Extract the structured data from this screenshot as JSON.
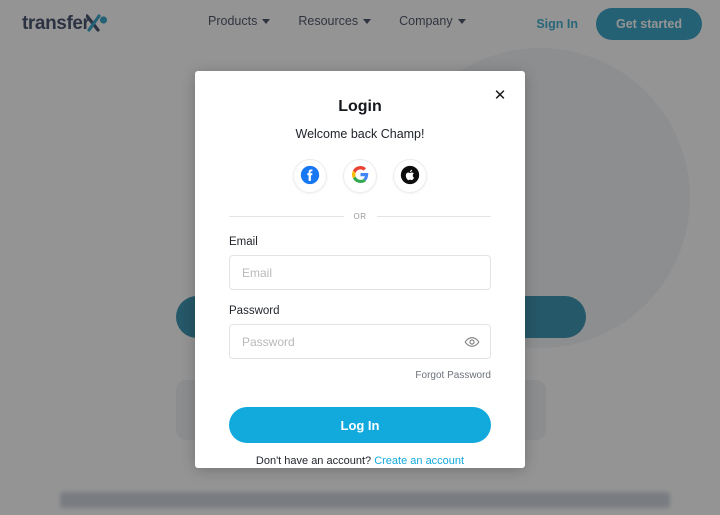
{
  "site": {
    "logo": {
      "text": "transfer",
      "mark_icon": "transferx-x-mark-icon",
      "text_color": "#18264a",
      "mark_color": "#0b8fb8"
    },
    "nav": {
      "items": [
        {
          "label": "Products",
          "has_dropdown": true
        },
        {
          "label": "Resources",
          "has_dropdown": true
        },
        {
          "label": "Company",
          "has_dropdown": true
        }
      ],
      "sign_in_label": "Sign In",
      "get_started_label": "Get started",
      "sign_in_color": "#0f9bc4",
      "get_started_bg": "#0b8fb8"
    }
  },
  "modal": {
    "title": "Login",
    "subtitle": "Welcome back Champ!",
    "close_icon": "close-icon",
    "social": {
      "buttons": [
        {
          "provider": "Facebook",
          "icon": "facebook-icon",
          "color": "#1877F2"
        },
        {
          "provider": "Google",
          "icon": "google-icon",
          "color": "#4285F4"
        },
        {
          "provider": "Apple",
          "icon": "apple-icon",
          "color": "#000000"
        }
      ]
    },
    "divider_text": "OR",
    "fields": {
      "email": {
        "label": "Email",
        "placeholder": "Email",
        "value": ""
      },
      "password": {
        "label": "Password",
        "placeholder": "Password",
        "value": "",
        "toggle_icon": "eye-icon"
      }
    },
    "forgot_password_label": "Forgot Password",
    "submit_label": "Log In",
    "submit_color": "#12a9dd",
    "signup_prompt": "Don't have an account?",
    "signup_link_label": "Create an account",
    "signup_link_color": "#12a9dd"
  },
  "overlay": {
    "color": "rgba(60, 60, 60, 0.55)"
  }
}
